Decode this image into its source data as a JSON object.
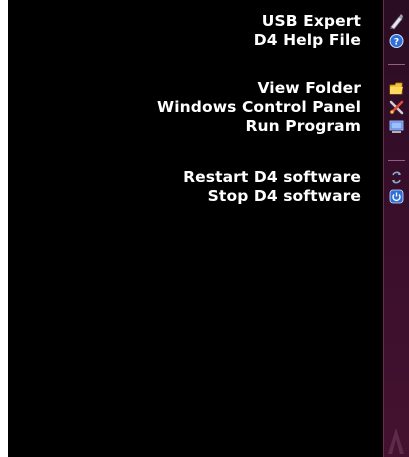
{
  "menu": {
    "group1": [
      {
        "label": "USB Expert",
        "icon": "usb-pen-icon"
      },
      {
        "label": "D4 Help File",
        "icon": "help-icon"
      }
    ],
    "group2": [
      {
        "label": "View Folder",
        "icon": "folder-icon"
      },
      {
        "label": "Windows Control Panel",
        "icon": "control-panel-tools-icon"
      },
      {
        "label": "Run Program",
        "icon": "run-program-icon"
      }
    ],
    "group3": [
      {
        "label": "Restart D4 software",
        "icon": "restart-icon"
      },
      {
        "label": "Stop D4 software",
        "icon": "power-icon"
      }
    ]
  },
  "colors": {
    "background": "#000000",
    "text": "#ffffff",
    "sidebar": "#3a0f2c",
    "divider": "#9a5a86"
  }
}
